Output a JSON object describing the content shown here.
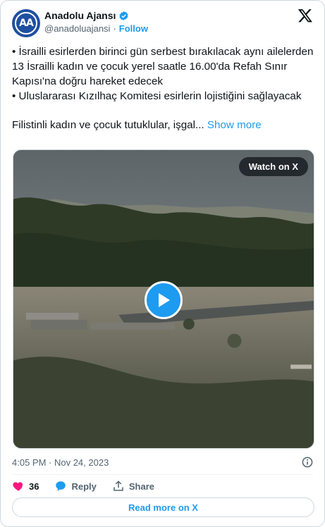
{
  "account": {
    "avatar_text": "AA",
    "display_name": "Anadolu Ajansı",
    "handle": "@anadoluajansi",
    "separator": "·",
    "follow_label": "Follow"
  },
  "tweet": {
    "lines": [
      "• İsrailli esirlerden birinci gün serbest bırakılacak aynı ailelerden 13 İsrailli kadın ve çocuk yerel saatle 16.00'da Refah Sınır Kapısı'na doğru hareket edecek",
      "• Uluslararası Kızılhaç Komitesi esirlerin lojistiğini sağlayacak"
    ],
    "truncated_text": "Filistinli kadın ve çocuk tutuklular, işgal...",
    "show_more_label": "Show more"
  },
  "media": {
    "watch_label": "Watch on X",
    "play_icon": "play-icon"
  },
  "footer": {
    "timestamp": "4:05 PM · Nov 24, 2023",
    "like_count": "36",
    "reply_label": "Reply",
    "share_label": "Share",
    "read_more_label": "Read more on X"
  },
  "colors": {
    "accent": "#1d9bf0",
    "like": "#f91880",
    "muted": "#536471"
  }
}
